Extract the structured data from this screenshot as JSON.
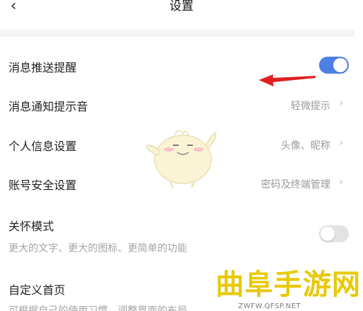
{
  "header": {
    "back_icon": "chevron-left-icon",
    "title": "设置"
  },
  "settings": {
    "push": {
      "label": "消息推送提醒",
      "enabled": true
    },
    "sound": {
      "label": "消息通知提示音",
      "value": "轻微提示"
    },
    "profile": {
      "label": "个人信息设置",
      "value": "头像、昵称"
    },
    "security": {
      "label": "账号安全设置",
      "value": "密码及终端管理"
    },
    "care": {
      "label": "关怀模式",
      "description": "更大的文字、更大的图标、更简单的功能",
      "enabled": false
    },
    "homepage": {
      "label": "自定义首页",
      "description": "可根据自己的使用习惯，调整界面的布局"
    }
  },
  "annotation": {
    "arrow_color": "#e02020"
  },
  "watermark": {
    "title": "曲阜手游网",
    "url": "ZWFW.QFSP.NET"
  },
  "colors": {
    "toggle_on": "#4e7fe6",
    "toggle_off": "#e3e3e3",
    "accent_watermark": "#e8c90a"
  }
}
